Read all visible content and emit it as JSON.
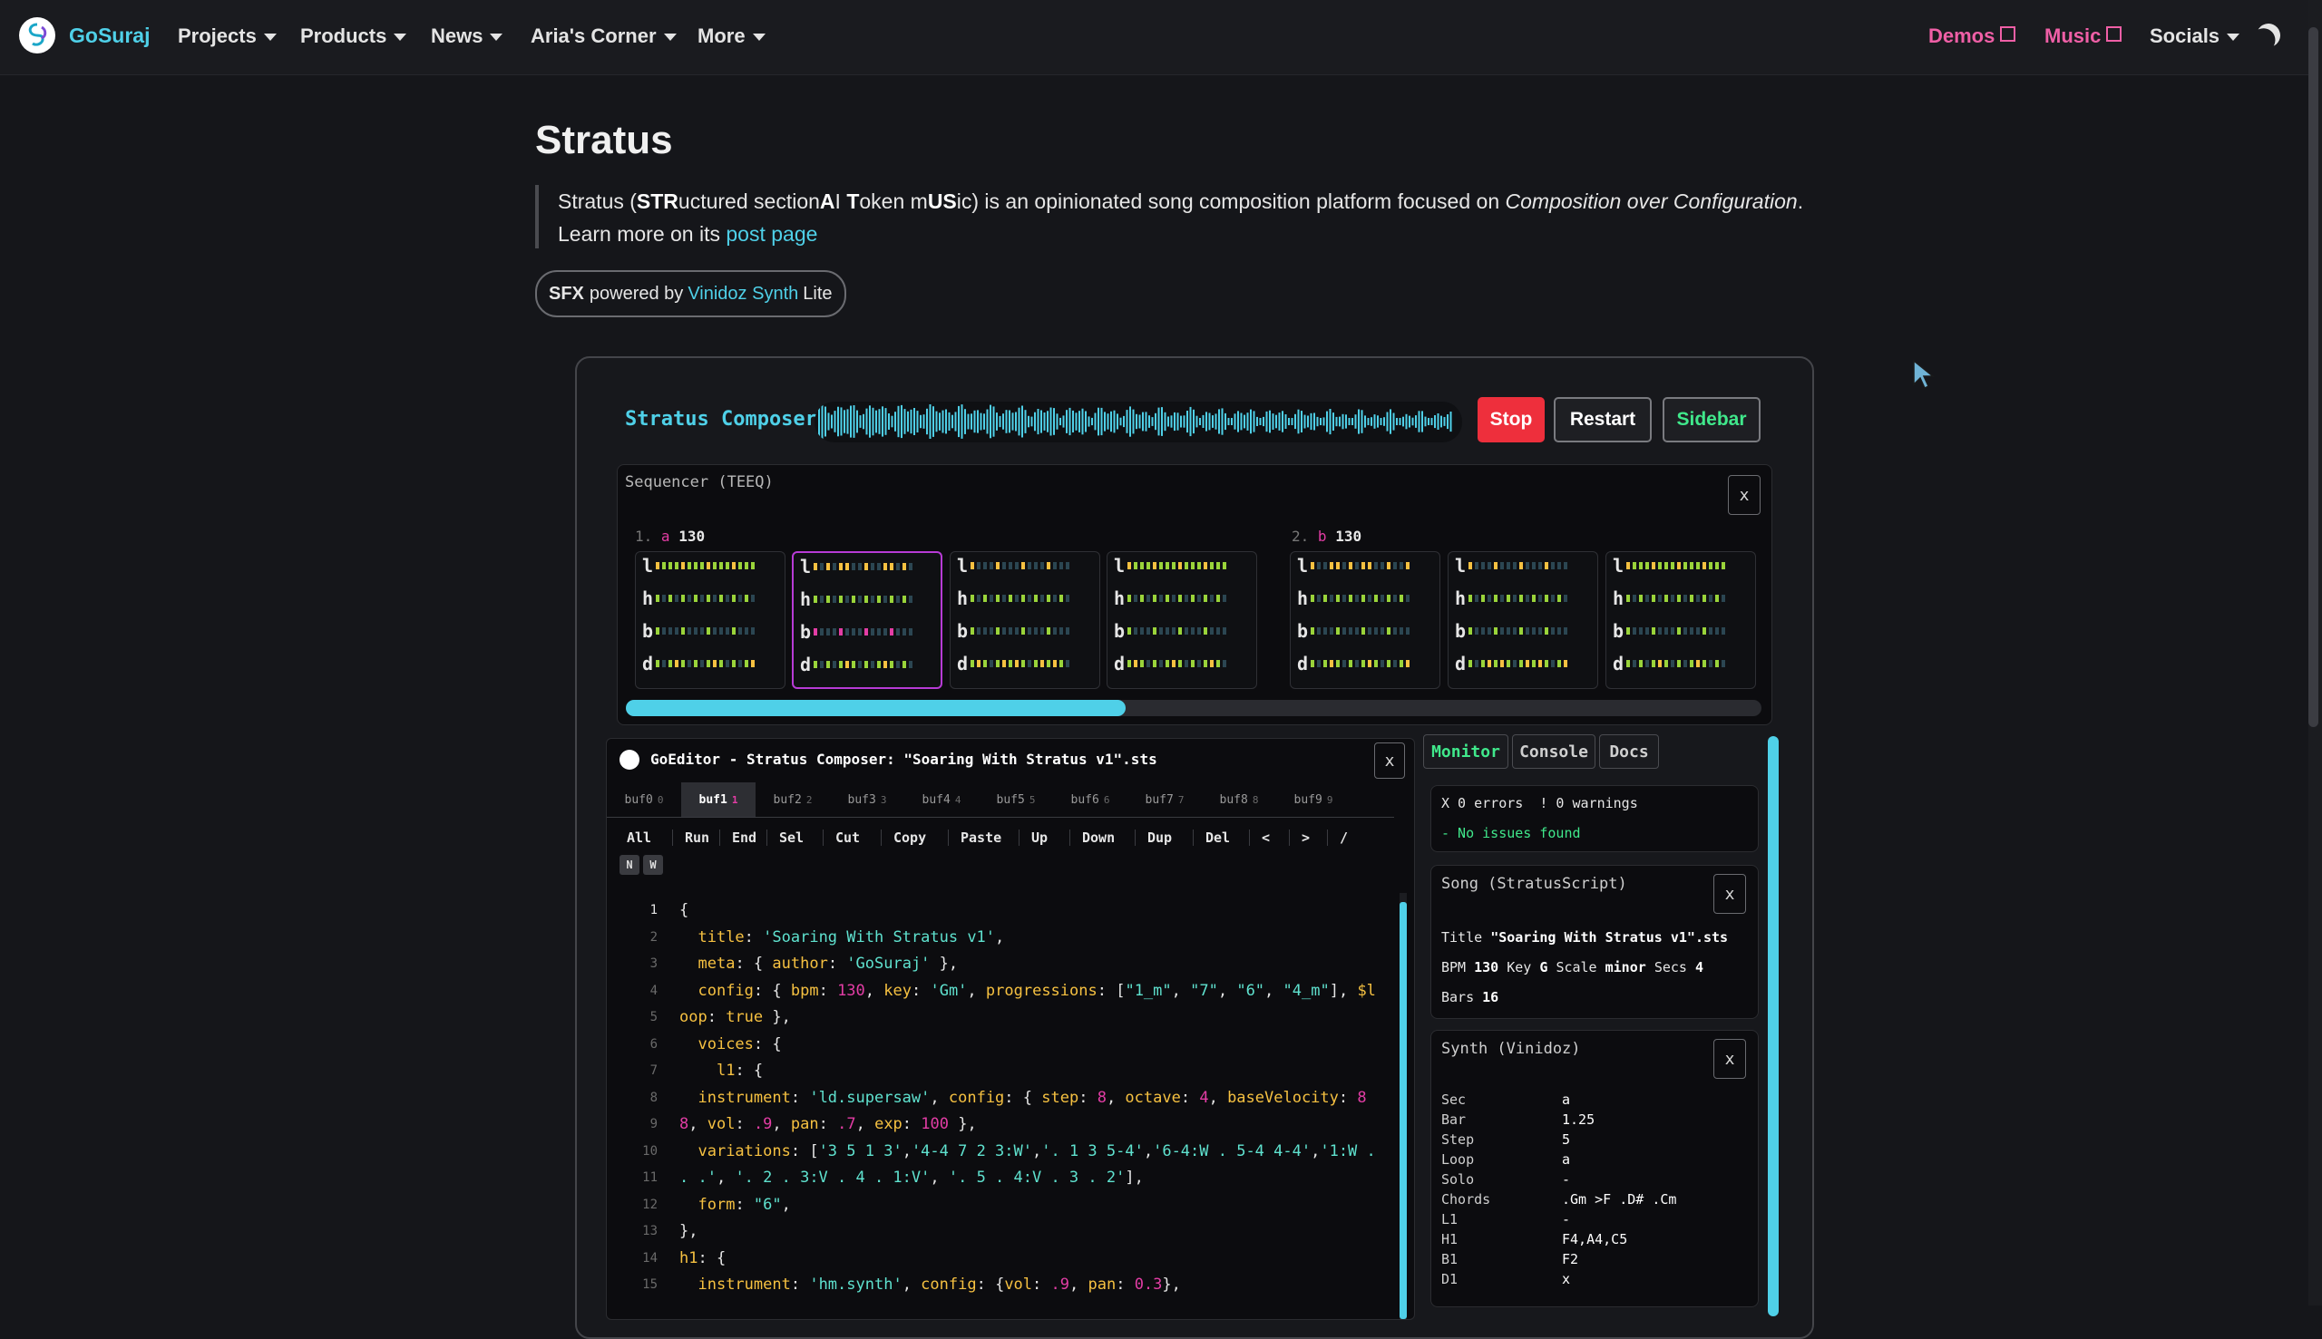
{
  "nav": {
    "brand": "GoSuraj",
    "items": [
      {
        "label": "Projects"
      },
      {
        "label": "Products"
      },
      {
        "label": "News"
      },
      {
        "label": "Aria's Corner"
      },
      {
        "label": "More"
      }
    ],
    "demos": "Demos",
    "music": "Music",
    "socials": "Socials"
  },
  "page": {
    "title": "Stratus",
    "desc_before": "Stratus (",
    "desc_b1": "STR",
    "desc_t1": "uctured section",
    "desc_b2": "A",
    "desc_t2": "I ",
    "desc_b3": "T",
    "desc_t3": "oken m",
    "desc_b4": "US",
    "desc_t4": "ic) is an opinionated song composition platform focused on ",
    "desc_italic": "Composition over Configuration",
    "desc_end": ".",
    "learn_more": "Learn more on its ",
    "post_link": "post page",
    "sfx_bold": "SFX",
    "sfx_text": "powered by",
    "sfx_link": "Vinidoz Synth",
    "sfx_lite": "Lite"
  },
  "composer": {
    "title": "Stratus Composer",
    "stop": "Stop",
    "restart": "Restart",
    "sidebar": "Sidebar",
    "progress_fraction": 0.44
  },
  "sequencer": {
    "title": "Sequencer (TEEQ)",
    "close": "x",
    "sections": [
      {
        "num": "1.",
        "name": "a",
        "bpm": "130"
      },
      {
        "num": "2.",
        "name": "b",
        "bpm": "130"
      }
    ],
    "row_letters": [
      "l",
      "h",
      "b",
      "d"
    ]
  },
  "editor": {
    "title": "GoEditor - Stratus Composer: \"Soaring With Stratus v1\".sts",
    "close": "x",
    "tabs": [
      {
        "label": "buf0",
        "sub": "0"
      },
      {
        "label": "buf1",
        "sub": "1"
      },
      {
        "label": "buf2",
        "sub": "2"
      },
      {
        "label": "buf3",
        "sub": "3"
      },
      {
        "label": "buf4",
        "sub": "4"
      },
      {
        "label": "buf5",
        "sub": "5"
      },
      {
        "label": "buf6",
        "sub": "6"
      },
      {
        "label": "buf7",
        "sub": "7"
      },
      {
        "label": "buf8",
        "sub": "8"
      },
      {
        "label": "buf9",
        "sub": "9"
      }
    ],
    "toolbar": [
      "All",
      "Run",
      "End",
      "Sel",
      "Cut",
      "Copy",
      "Paste",
      "Up",
      "Down",
      "Dup",
      "Del",
      "<",
      ">",
      "/"
    ],
    "mode_buttons": [
      "N",
      "W"
    ],
    "line_numbers": [
      "1",
      "2",
      "3",
      "4",
      "5",
      "6",
      "7",
      "8",
      "9",
      "10",
      "11",
      "12",
      "13",
      "14",
      "15"
    ]
  },
  "monitor": {
    "tabs": [
      "Monitor",
      "Console",
      "Docs"
    ],
    "errors": "X 0 errors",
    "warnings": "! 0 warnings",
    "no_issues": "- No issues found",
    "song_title": "Song (StratusScript)",
    "song_close": "x",
    "song_title_label": "Title",
    "song_title_value": "\"Soaring With Stratus v1\".sts",
    "bpm_label": "BPM",
    "bpm_value": "130",
    "key_label": "Key",
    "key_value": "G",
    "scale_label": "Scale",
    "scale_value": "minor",
    "secs_label": "Secs",
    "secs_value": "4",
    "bars_label": "Bars",
    "bars_value": "16",
    "synth_title": "Synth (Vinidoz)",
    "synth_close": "x",
    "synth_rows": [
      {
        "k": "Sec",
        "v": "a"
      },
      {
        "k": "Bar",
        "v": "1.25"
      },
      {
        "k": "Step",
        "v": "5"
      },
      {
        "k": "Loop",
        "v": "a"
      },
      {
        "k": "Solo",
        "v": "-"
      },
      {
        "k": "Chords",
        "v": ".Gm >F .D# .Cm"
      },
      {
        "k": "L1",
        "v": "-"
      },
      {
        "k": "H1",
        "v": "F4,A4,C5"
      },
      {
        "k": "B1",
        "v": "F2"
      },
      {
        "k": "D1",
        "v": "x"
      }
    ]
  },
  "colors": {
    "accent": "#4fd0e8",
    "pink": "#ef5fa6",
    "stop": "#ee2f3c",
    "green": "#40e88b",
    "select": "#b73bd6"
  }
}
